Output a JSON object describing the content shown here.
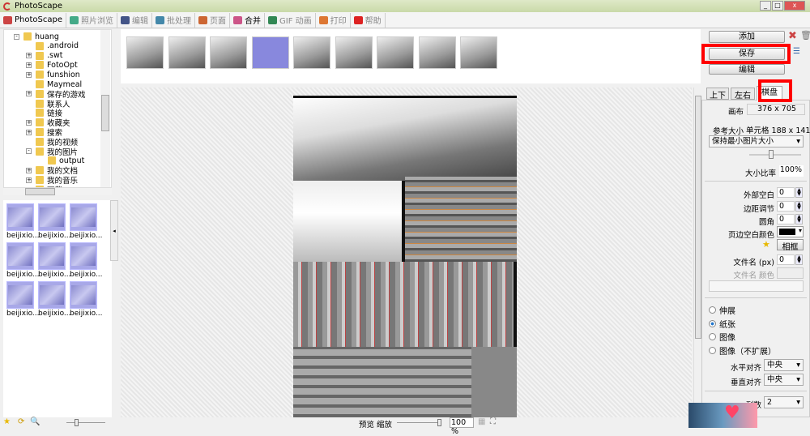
{
  "title": "PhotoScape",
  "tabs": [
    {
      "label": "PhotoScape",
      "color": "#c44"
    },
    {
      "label": "照片浏览",
      "color": "#4a8"
    },
    {
      "label": "编辑",
      "color": "#458"
    },
    {
      "label": "批处理",
      "color": "#48a"
    },
    {
      "label": "页面",
      "color": "#c63"
    },
    {
      "label": "合并",
      "color": "#c58"
    },
    {
      "label": "GIF 动画",
      "color": "#385"
    },
    {
      "label": "打印",
      "color": "#d73"
    },
    {
      "label": "帮助",
      "color": "#d22"
    }
  ],
  "tree": [
    {
      "label": "huang",
      "exp": "-"
    },
    {
      "label": ".android",
      "exp": ""
    },
    {
      "label": ".swt",
      "exp": "+"
    },
    {
      "label": "FotoOpt",
      "exp": "+"
    },
    {
      "label": "funshion",
      "exp": "+"
    },
    {
      "label": "Maymeal",
      "exp": ""
    },
    {
      "label": "保存的游戏",
      "exp": "+"
    },
    {
      "label": "联系人",
      "exp": ""
    },
    {
      "label": "链接",
      "exp": ""
    },
    {
      "label": "收藏夹",
      "exp": "+"
    },
    {
      "label": "搜索",
      "exp": "+"
    },
    {
      "label": "我的视频",
      "exp": ""
    },
    {
      "label": "我的图片",
      "exp": "-"
    },
    {
      "label": "output",
      "exp": ""
    },
    {
      "label": "我的文档",
      "exp": "+"
    },
    {
      "label": "我的音乐",
      "exp": "+"
    },
    {
      "label": "下载",
      "exp": ""
    }
  ],
  "thumbs": [
    "beijixio...",
    "beijixio...",
    "beijixio...",
    "beijixio...",
    "beijixio...",
    "beijixio...",
    "beijixio...",
    "beijixio...",
    "beijixio..."
  ],
  "right": {
    "add": "添加",
    "save": "保存",
    "edit": "编辑",
    "subtabs": [
      "上下",
      "左右",
      "棋盘"
    ],
    "canvas_label": "画布",
    "canvas_value": "376 x 705",
    "ref_label": "参考大小",
    "cell_value": "单元格 188 x 141",
    "keep_option": "保持最小图片大小",
    "ratio_label": "大小比率",
    "ratio_value": "100%",
    "outer_label": "外部空白",
    "outer_value": "0",
    "margin_label": "边距调节",
    "margin_value": "0",
    "corner_label": "圆角",
    "corner_value": "0",
    "bgcolor_label": "页边空白颜色",
    "bgcolor": "#000000",
    "frame_btn": "相框",
    "filename_label": "文件名 (px)",
    "filename_value": "0",
    "filename_color_label": "文件名 颜色",
    "radios": [
      {
        "label": "伸展",
        "on": false
      },
      {
        "label": "纸张",
        "on": true
      },
      {
        "label": "图像",
        "on": false
      },
      {
        "label": "图像（不扩展）",
        "on": false
      }
    ],
    "halign_label": "水平对齐",
    "halign": "中央",
    "valign_label": "垂直对齐",
    "valign": "中央",
    "columns_label": "列数",
    "columns": "2"
  },
  "bottom": {
    "zoom_label": "预览 缩放",
    "zoom_value": "100 %"
  }
}
